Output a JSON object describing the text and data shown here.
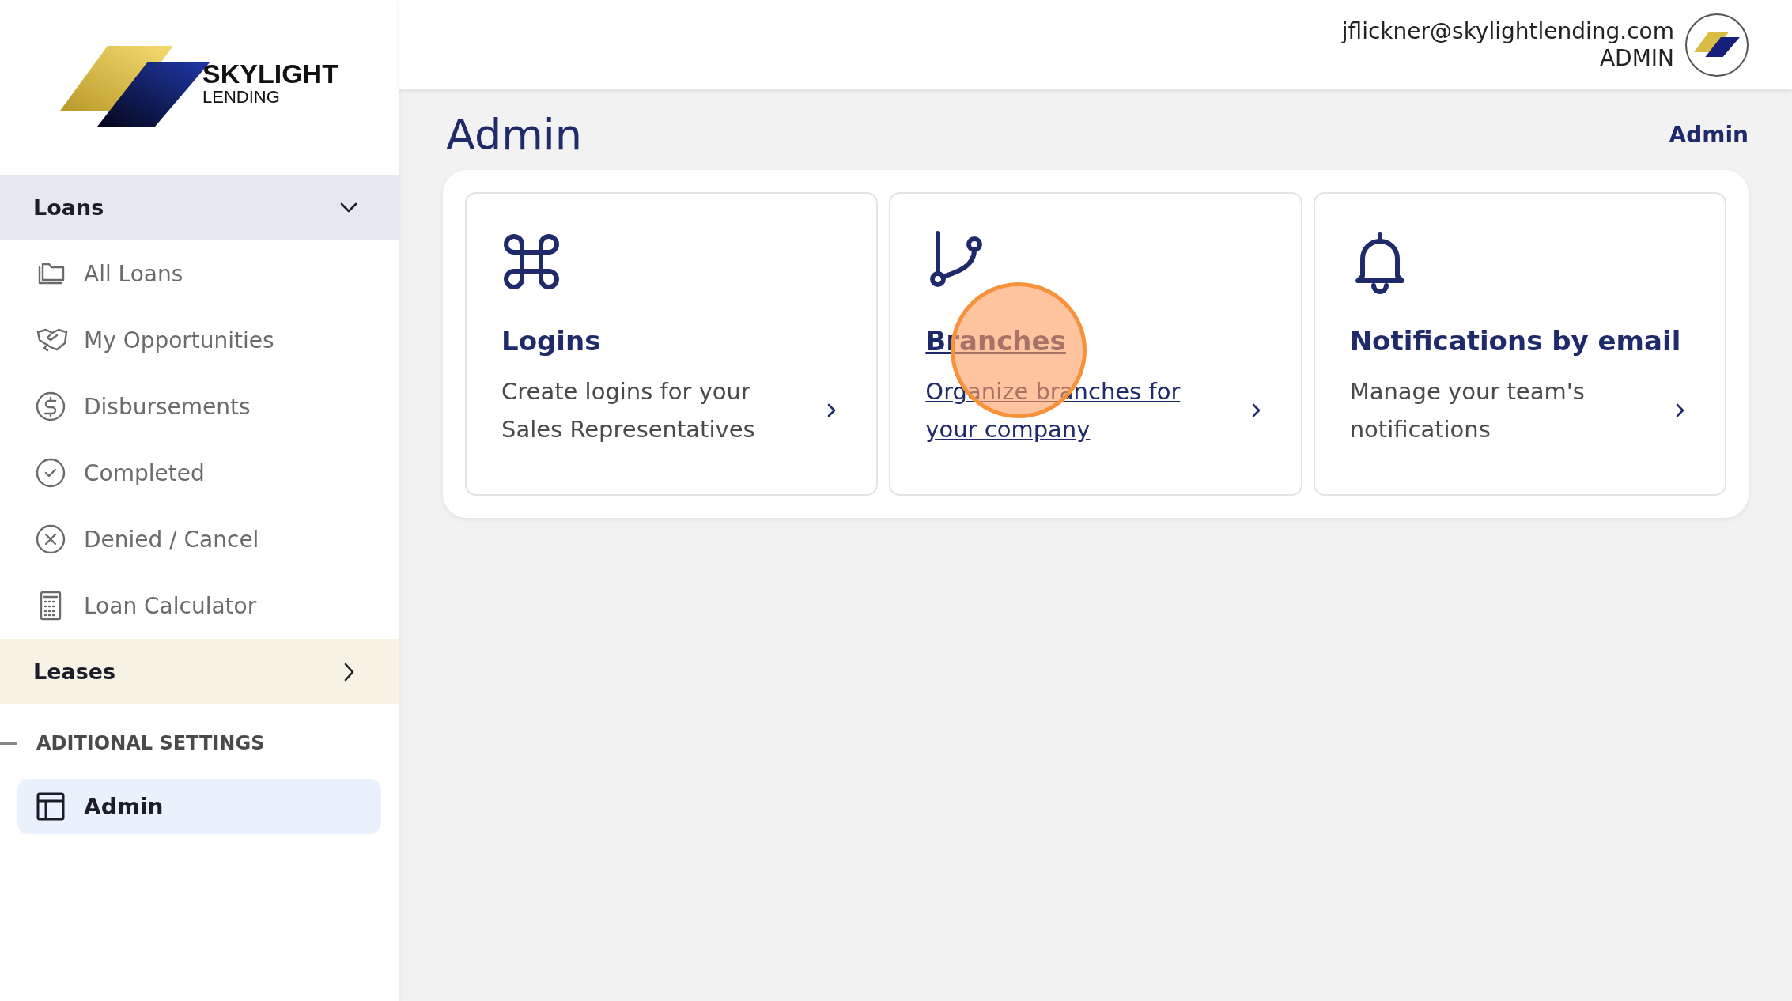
{
  "sidebar": {
    "logo": {
      "name": "SKYLIGHT",
      "subtitle": "LENDING"
    },
    "groups": [
      {
        "label": "Loans",
        "expanded": true,
        "color": "#e6e7ef",
        "items": [
          {
            "label": "All Loans",
            "selected": false
          },
          {
            "label": "My Opportunities",
            "selected": false
          },
          {
            "label": "Disbursements",
            "selected": false
          },
          {
            "label": "Completed",
            "selected": false
          },
          {
            "label": "Denied / Cancel",
            "selected": false
          },
          {
            "label": "Loan Calculator",
            "selected": false
          }
        ]
      },
      {
        "label": "Leases",
        "expanded": false,
        "color": "#f7f3e4"
      }
    ],
    "settings_heading": "ADITIONAL SETTINGS",
    "settings_items": [
      {
        "label": "Admin",
        "selected": true
      }
    ]
  },
  "header": {
    "email": "jflickner@skylightlending.com",
    "role": "ADMIN"
  },
  "page": {
    "title": "Admin",
    "breadcrumb": "Admin"
  },
  "cards": [
    {
      "title": "Logins",
      "description": "Create logins for your Sales Representatives",
      "hovered": false
    },
    {
      "title": "Branches",
      "description": "Organize branches for your company",
      "hovered": true
    },
    {
      "title": "Notifications by email",
      "description": "Manage your team's notifications",
      "hovered": false
    }
  ]
}
